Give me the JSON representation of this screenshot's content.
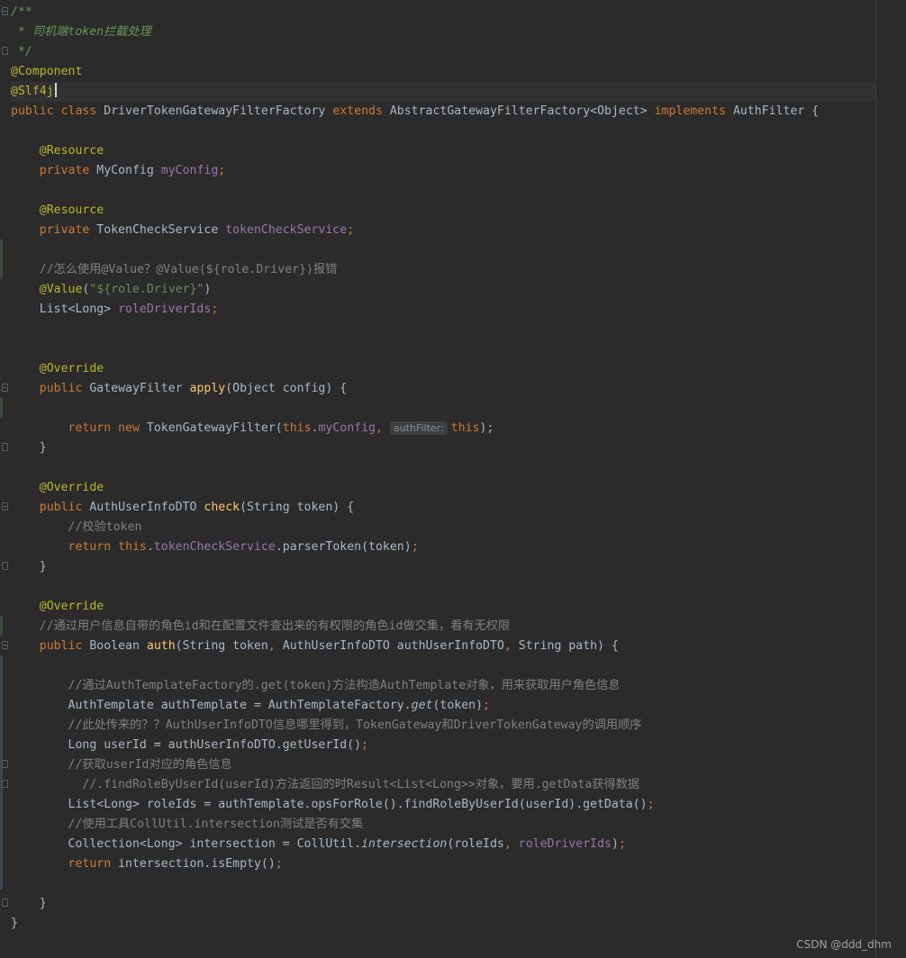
{
  "code_lines": [
    [
      "/**"
    ],
    [
      " * 司机端token拦截处理"
    ],
    [
      " */"
    ],
    [
      "@Component"
    ],
    [
      "@Slf4j"
    ],
    [
      "public",
      " ",
      "class",
      " DriverTokenGatewayFilterFactory ",
      "extends",
      " AbstractGatewayFilterFactory<Object> ",
      "implements",
      " AuthFilter {"
    ],
    [
      ""
    ],
    [
      "    ",
      "@Resource"
    ],
    [
      "    ",
      "private",
      " MyConfig ",
      "myConfig",
      ";"
    ],
    [
      ""
    ],
    [
      "    ",
      "@Resource"
    ],
    [
      "    ",
      "private",
      " TokenCheckService ",
      "tokenCheckService",
      ";"
    ],
    [
      ""
    ],
    [
      "    ",
      "//怎么使用@Value？@Value(${role.Driver})报错"
    ],
    [
      "    ",
      "@Value",
      "(",
      "\"${role.Driver}\"",
      ")"
    ],
    [
      "    List<Long> ",
      "roleDriverIds",
      ";"
    ],
    [
      ""
    ],
    [
      ""
    ],
    [
      "    ",
      "@Override"
    ],
    [
      "    ",
      "public",
      " GatewayFilter ",
      "apply",
      "(Object config) {"
    ],
    [
      ""
    ],
    [
      "        ",
      "return",
      " ",
      "new",
      " TokenGatewayFilter(",
      "this",
      ".",
      "myConfig",
      ",",
      "authFilter:",
      "this",
      ");"
    ],
    [
      "    }"
    ],
    [
      ""
    ],
    [
      "    ",
      "@Override"
    ],
    [
      "    ",
      "public",
      " AuthUserInfoDTO ",
      "check",
      "(String token) {"
    ],
    [
      "        ",
      "//校验token"
    ],
    [
      "        ",
      "return",
      " ",
      "this",
      ".",
      "tokenCheckService",
      ".parserToken(token)",
      ";"
    ],
    [
      "    }"
    ],
    [
      ""
    ],
    [
      "    ",
      "@Override"
    ],
    [
      "    ",
      "//通过用户信息自带的角色id和在配置文件查出来的有权限的角色id做交集，看有无权限"
    ],
    [
      "    ",
      "public",
      " Boolean ",
      "auth",
      "(String token",
      ",",
      " AuthUserInfoDTO authUserInfoDTO",
      ",",
      " String path) {"
    ],
    [
      ""
    ],
    [
      "        ",
      "//通过AuthTemplateFactory的.get(token)方法构造AuthTemplate对象，用来获取用户角色信息"
    ],
    [
      "        AuthTemplate authTemplate = AuthTemplateFactory.",
      "get",
      "(token)",
      ";"
    ],
    [
      "        ",
      "//此处传来的？？AuthUserInfoDTO信息哪里得到，TokenGateway和DriverTokenGateway的调用顺序"
    ],
    [
      "        Long userId = authUserInfoDTO.getUserId()",
      ";"
    ],
    [
      "        ",
      "//获取userId对应的角色信息"
    ],
    [
      "          ",
      "//.findRoleByUserId(userId)方法返回的时Result<List<Long>>对象，要用.getData获得数据"
    ],
    [
      "        List<Long> roleIds = authTemplate.opsForRole().findRoleByUserId(userId).getData()",
      ";"
    ],
    [
      "        ",
      "//使用工具CollUtil.intersection测试是否有交集"
    ],
    [
      "        Collection<Long> intersection = CollUtil.",
      "intersection",
      "(roleIds",
      ",",
      " ",
      "roleDriverIds",
      ")",
      ";"
    ],
    [
      "        ",
      "return",
      " intersection.isEmpty()",
      ";"
    ],
    [
      ""
    ],
    [
      "    }"
    ],
    [
      "}"
    ]
  ],
  "watermark": "CSDN @ddd_dhm"
}
